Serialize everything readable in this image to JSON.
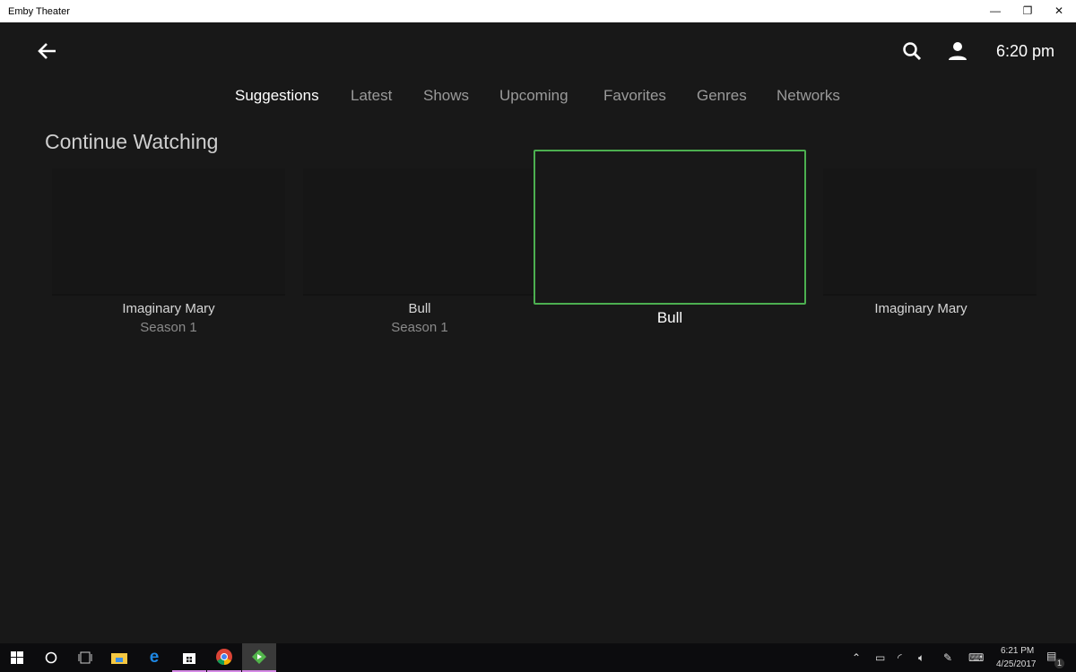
{
  "window": {
    "title": "Emby Theater",
    "minimize": "—",
    "restore": "❐",
    "close": "✕"
  },
  "header": {
    "time": "6:20 pm"
  },
  "tabs": [
    {
      "label": "Suggestions",
      "active": true
    },
    {
      "label": "Latest"
    },
    {
      "label": "Shows"
    },
    {
      "label": "Upcoming"
    },
    {
      "label": "Favorites"
    },
    {
      "label": "Genres"
    },
    {
      "label": "Networks"
    }
  ],
  "section": {
    "title": "Continue Watching"
  },
  "cards": [
    {
      "title": "Imaginary Mary",
      "subtitle": "Season 1"
    },
    {
      "title": "Bull",
      "subtitle": "Season 1"
    },
    {
      "title": "Bull",
      "focused": true
    },
    {
      "title": "Imaginary Mary"
    }
  ],
  "taskbar": {
    "time": "6:21 PM",
    "date": "4/25/2017",
    "notifications": "1",
    "accent": "#4caf50"
  }
}
